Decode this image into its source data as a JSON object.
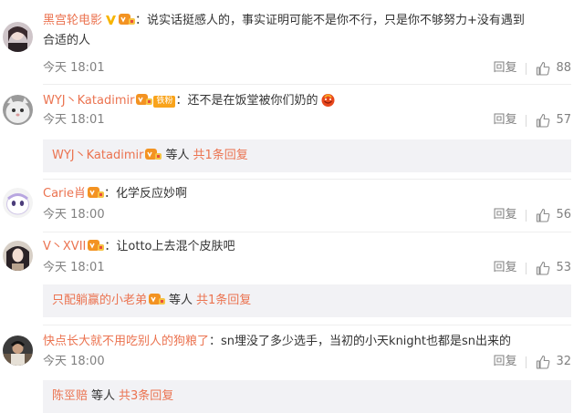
{
  "comments": [
    {
      "username": "黑宫轮电影",
      "has_v": true,
      "has_vip": true,
      "text_line1": "说实话挺感人的，事实证明可能不是你不行，只是你不够努力+没有遇到",
      "text_line2": "合适的人",
      "time": "今天 18:01",
      "reply_label": "回复",
      "likes": "88"
    },
    {
      "username": "WYJ丶Katadimir",
      "has_vip": true,
      "fan_badge": "铁粉",
      "text_line1": "还不是在饭堂被你们奶的",
      "time": "今天 18:01",
      "reply_label": "回复",
      "likes": "57",
      "sub": {
        "user": "WYJ丶Katadimir",
        "etc": "等人",
        "count": "共1条回复"
      }
    },
    {
      "username": "Carie肖",
      "has_vip": true,
      "text_line1": "化学反应妙啊",
      "time": "今天 18:00",
      "reply_label": "回复",
      "likes": "56"
    },
    {
      "username": "V丶XVII",
      "has_vip": true,
      "text_line1": "让otto上去混个皮肤吧",
      "time": "今天 18:01",
      "reply_label": "回复",
      "likes": "53",
      "sub": {
        "user": "只配躺赢的小老弟",
        "etc": "等人",
        "count": "共1条回复"
      }
    },
    {
      "username": "快点长大就不用吃别人的狗粮了",
      "text_line1": "sn埋没了多少选手，当初的小天knight也都是sn出来的",
      "time": "今天 18:00",
      "reply_label": "回复",
      "likes": "32",
      "sub": {
        "user": "陈巠赔",
        "etc": "等人",
        "count": "共3条回复"
      }
    }
  ],
  "colors": {
    "username": "#eb7350",
    "meta": "#808080",
    "sub_bg": "#f2f2f5"
  }
}
